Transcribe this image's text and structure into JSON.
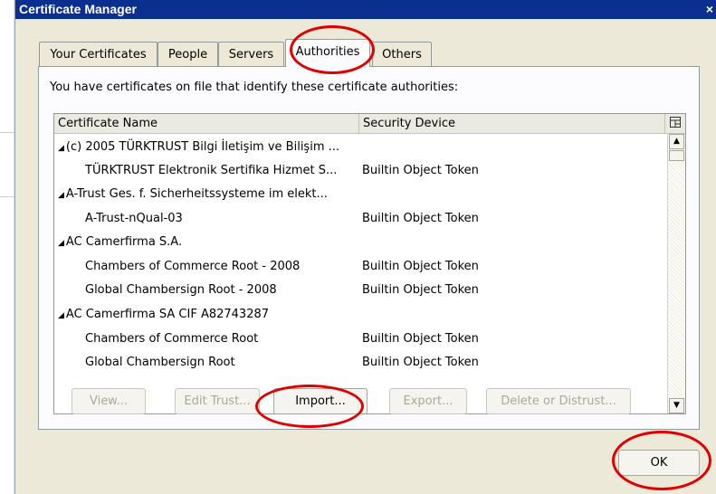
{
  "window": {
    "title": "Certificate Manager",
    "close_glyph": "×"
  },
  "tabs": [
    {
      "label": "Your Certificates",
      "active": false
    },
    {
      "label": "People",
      "active": false
    },
    {
      "label": "Servers",
      "active": false
    },
    {
      "label": "Authorities",
      "active": true
    },
    {
      "label": "Others",
      "active": false
    }
  ],
  "panel": {
    "description": "You have certificates on file that identify these certificate authorities:"
  },
  "table": {
    "columns": [
      "Certificate Name",
      "Security Device"
    ],
    "column_picker_icon": "column-picker-icon",
    "rows": [
      {
        "name": "(c) 2005 TÜRKTRUST Bilgi İletişim ve Bilişim ...",
        "device": "",
        "group": true
      },
      {
        "name": "TÜRKTRUST Elektronik Sertifika Hizmet S...",
        "device": "Builtin Object Token",
        "group": false
      },
      {
        "name": "A-Trust Ges. f. Sicherheitssysteme im elekt...",
        "device": "",
        "group": true
      },
      {
        "name": "A-Trust-nQual-03",
        "device": "Builtin Object Token",
        "group": false
      },
      {
        "name": "AC Camerfirma S.A.",
        "device": "",
        "group": true
      },
      {
        "name": "Chambers of Commerce Root - 2008",
        "device": "Builtin Object Token",
        "group": false
      },
      {
        "name": "Global Chambersign Root - 2008",
        "device": "Builtin Object Token",
        "group": false
      },
      {
        "name": "AC Camerfirma SA CIF A82743287",
        "device": "",
        "group": true
      },
      {
        "name": "Chambers of Commerce Root",
        "device": "Builtin Object Token",
        "group": false
      },
      {
        "name": "Global Chambersign Root",
        "device": "Builtin Object Token",
        "group": false
      }
    ]
  },
  "buttons": {
    "view": "View...",
    "edit_trust": "Edit Trust...",
    "import": "Import...",
    "export": "Export...",
    "delete": "Delete or Distrust...",
    "ok": "OK"
  },
  "colors": {
    "titlebar": "#0a2f8e",
    "dialog_bg": "#ece9d8",
    "annotation_ring": "#e00000"
  }
}
